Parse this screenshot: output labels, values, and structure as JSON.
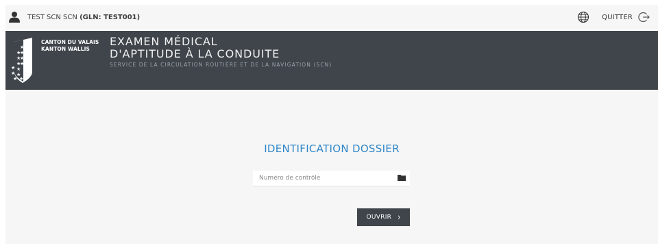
{
  "topbar": {
    "user_name": "TEST SCN SCN",
    "user_gln": "(GLN: TEST001)",
    "quit_label": "QUITTER"
  },
  "banner": {
    "canton_fr": "CANTON DU VALAIS",
    "canton_de": "KANTON WALLIS",
    "title_line1": "EXAMEN MÉDICAL",
    "title_line2": "D'APTITUDE À LA CONDUITE",
    "subtitle": "SERVICE DE LA CIRCULATION ROUTIÈRE ET DE LA NAVIGATION (SCN)"
  },
  "form": {
    "heading": "IDENTIFICATION DOSSIER",
    "control_number_value": "",
    "control_number_placeholder": "Numéro de contrôle",
    "open_label": "OUVRIR",
    "open_chevron": "›"
  },
  "icons": {
    "user": "user-icon",
    "globe": "globe-icon",
    "logout": "logout-icon",
    "folder": "folder-icon",
    "crest": "valais-crest-icon"
  },
  "colors": {
    "banner_bg": "#3f454b",
    "heading_blue": "#2f86c9",
    "page_bg": "#f6f6f6"
  }
}
